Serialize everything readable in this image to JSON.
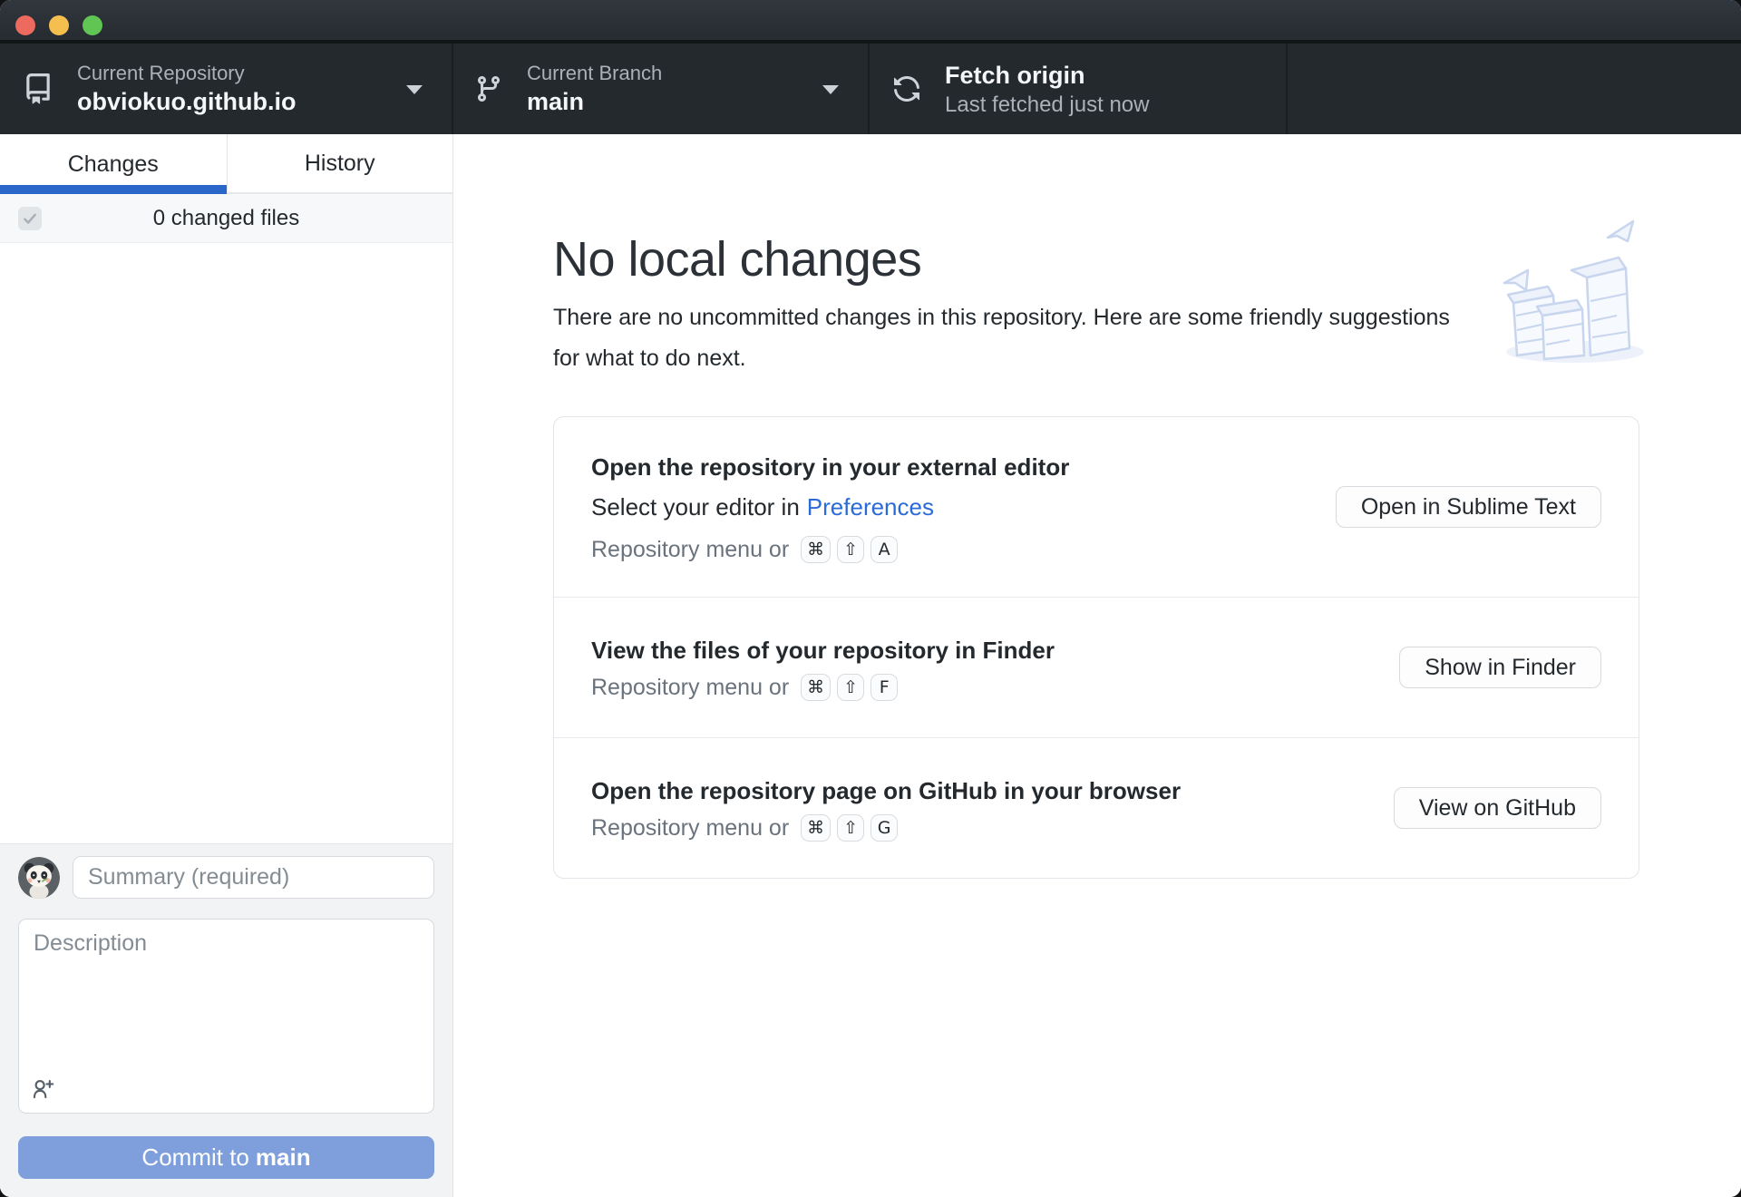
{
  "window": {
    "controls": {
      "close": "close",
      "minimize": "minimize",
      "zoom": "zoom"
    }
  },
  "toolbar": {
    "repository": {
      "label": "Current Repository",
      "value": "obviokuo.github.io"
    },
    "branch": {
      "label": "Current Branch",
      "value": "main"
    },
    "fetch": {
      "title": "Fetch origin",
      "subtitle": "Last fetched just now"
    }
  },
  "sidebar": {
    "tabs": [
      {
        "label": "Changes",
        "active": true
      },
      {
        "label": "History",
        "active": false
      }
    ],
    "changed_files": {
      "count_label": "0 changed files"
    },
    "commit_form": {
      "summary_placeholder": "Summary (required)",
      "description_placeholder": "Description",
      "commit_button": {
        "prefix": "Commit to",
        "branch": "main"
      }
    }
  },
  "main": {
    "heading": "No local changes",
    "description": "There are no uncommitted changes in this repository. Here are some friendly suggestions for what to do next.",
    "suggestions": [
      {
        "title": "Open the repository in your external editor",
        "subtitle_prefix": "Select your editor in",
        "subtitle_link": "Preferences",
        "shortcut_prefix": "Repository menu or",
        "keys": [
          "⌘",
          "⇧",
          "A"
        ],
        "button": "Open in Sublime Text"
      },
      {
        "title": "View the files of your repository in Finder",
        "shortcut_prefix": "Repository menu or",
        "keys": [
          "⌘",
          "⇧",
          "F"
        ],
        "button": "Show in Finder"
      },
      {
        "title": "Open the repository page on GitHub in your browser",
        "shortcut_prefix": "Repository menu or",
        "keys": [
          "⌘",
          "⇧",
          "G"
        ],
        "button": "View on GitHub"
      }
    ]
  },
  "colors": {
    "toolbar_background": "#24292e",
    "active_tab_underline": "#2b66c9",
    "link_blue": "#2a6ad9",
    "commit_button_disabled": "#7e9fdb",
    "traffic_red": "#ec6a5e",
    "traffic_yellow": "#f4bf4f",
    "traffic_green": "#61c554"
  }
}
